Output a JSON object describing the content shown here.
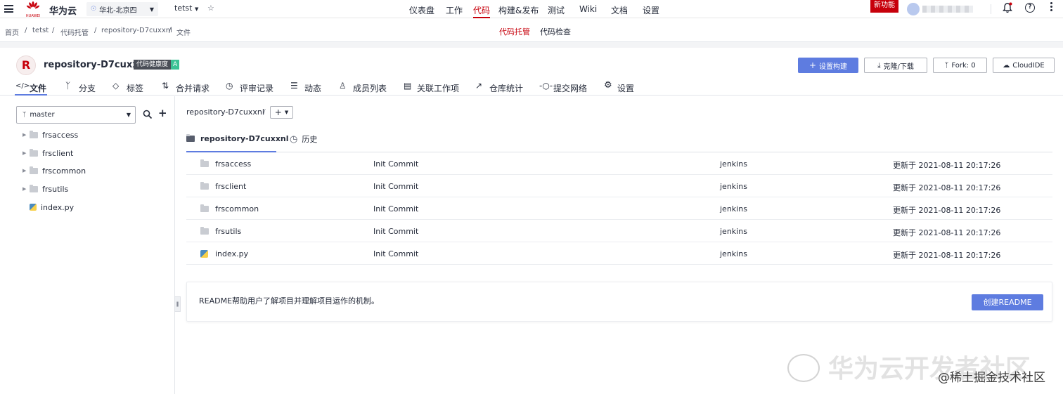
{
  "topbar": {
    "brand_small": "HUAWEI",
    "brand_name": "华为云",
    "region": "华北-北京四",
    "project": "tetst",
    "nav": [
      "仪表盘",
      "工作",
      "代码",
      "构建&发布",
      "测试",
      "Wiki",
      "文档",
      "设置"
    ],
    "active_nav": "代码",
    "new_feature_badge": "新功能",
    "accent_color": "#c7000b"
  },
  "breadcrumb": [
    "首页",
    "tetst",
    "代码托管",
    "repository-D7cuxxnl",
    "文件"
  ],
  "subnav": {
    "active": "代码托管",
    "other": "代码检查"
  },
  "repo": {
    "avatar_letter": "R",
    "name": "repository-D7cuxxnl",
    "health_label": "代码健康度",
    "health_grade": "A",
    "buttons": {
      "build": "设置构建",
      "clone": "克隆/下载",
      "fork": "Fork: 0",
      "ide": "CloudIDE"
    },
    "tabs": [
      "文件",
      "分支",
      "标签",
      "合并请求",
      "评审记录",
      "动态",
      "成员列表",
      "关联工作项",
      "仓库统计",
      "提交网络",
      "设置"
    ]
  },
  "sidebar": {
    "branch": "master",
    "tree": [
      {
        "name": "frsaccess",
        "type": "folder"
      },
      {
        "name": "frsclient",
        "type": "folder"
      },
      {
        "name": "frscommon",
        "type": "folder"
      },
      {
        "name": "frsutils",
        "type": "folder"
      },
      {
        "name": "index.py",
        "type": "python"
      }
    ]
  },
  "main": {
    "path_root": "repository-D7cuxxnl",
    "path_sep": "/",
    "add_symbol": "+",
    "tab_repo": "repository-D7cuxxnl",
    "tab_history": "历史",
    "files": [
      {
        "name": "frsaccess",
        "type": "folder",
        "commit": "Init Commit",
        "author": "jenkins",
        "updated": "更新于 2021-08-11 20:17:26"
      },
      {
        "name": "frsclient",
        "type": "folder",
        "commit": "Init Commit",
        "author": "jenkins",
        "updated": "更新于 2021-08-11 20:17:26"
      },
      {
        "name": "frscommon",
        "type": "folder",
        "commit": "Init Commit",
        "author": "jenkins",
        "updated": "更新于 2021-08-11 20:17:26"
      },
      {
        "name": "frsutils",
        "type": "folder",
        "commit": "Init Commit",
        "author": "jenkins",
        "updated": "更新于 2021-08-11 20:17:26"
      },
      {
        "name": "index.py",
        "type": "python",
        "commit": "Init Commit",
        "author": "jenkins",
        "updated": "更新于 2021-08-11 20:17:26"
      }
    ],
    "readme_text": "README帮助用户了解项目并理解项目运作的机制。",
    "readme_button": "创建README"
  },
  "watermark": {
    "line1": "华为云开发者社区",
    "line2": "@稀土掘金技术社区"
  }
}
